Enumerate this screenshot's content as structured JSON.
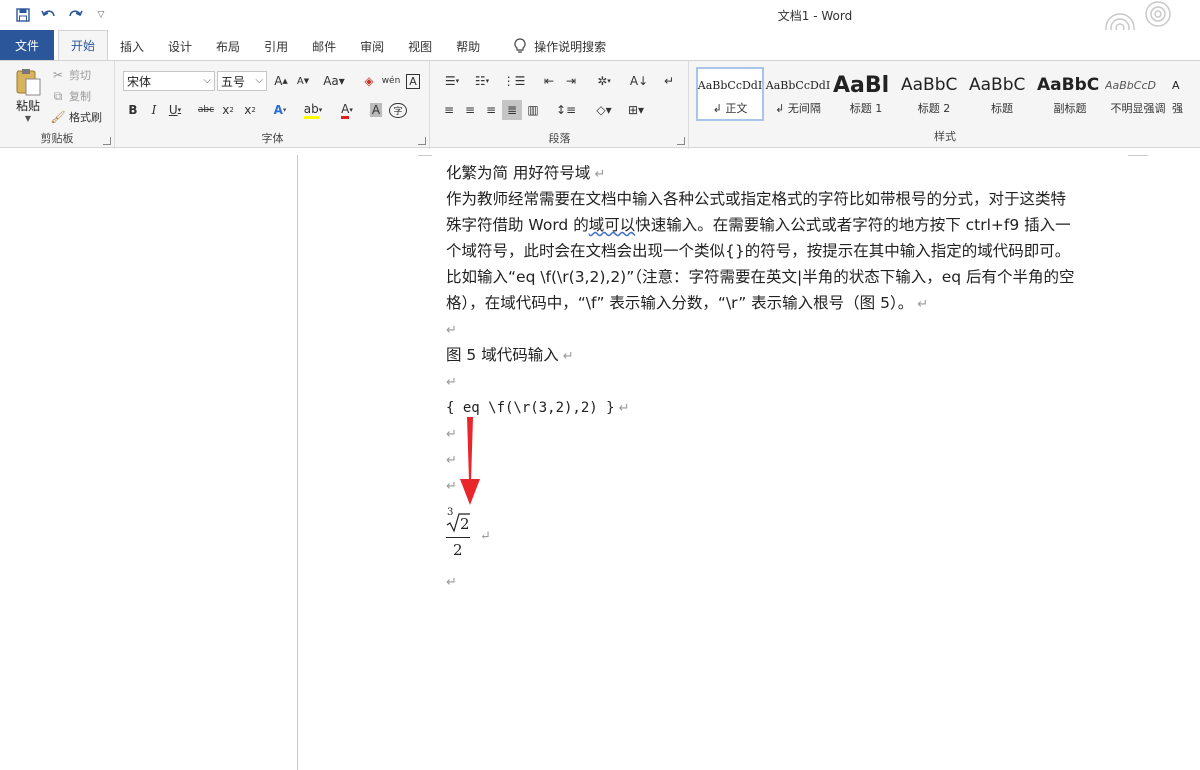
{
  "window": {
    "title": "文档1  -  Word"
  },
  "qat": {
    "save_icon": "save-icon",
    "undo_icon": "undo-icon",
    "redo_icon": "redo-icon",
    "customize_icon": "chevron-down-icon"
  },
  "tabs": {
    "file": "文件",
    "home": "开始",
    "insert": "插入",
    "design": "设计",
    "layout": "布局",
    "references": "引用",
    "mailings": "邮件",
    "review": "审阅",
    "view": "视图",
    "help": "帮助",
    "tellme": "操作说明搜索"
  },
  "clipboard": {
    "paste": "粘贴",
    "cut": "剪切",
    "copy": "复制",
    "format_painter": "格式刷",
    "label": "剪贴板"
  },
  "font": {
    "name": "宋体",
    "size": "五号",
    "label": "字体"
  },
  "paragraph": {
    "label": "段落"
  },
  "styles": {
    "label": "样式",
    "items": [
      {
        "sample": "AaBbCcDdI",
        "name": "↲ 正文"
      },
      {
        "sample": "AaBbCcDdI",
        "name": "↲ 无间隔"
      },
      {
        "sample": "AaBl",
        "name": "标题 1"
      },
      {
        "sample": "AaBbC",
        "name": "标题 2"
      },
      {
        "sample": "AaBbC",
        "name": "标题"
      },
      {
        "sample": "AaBbC",
        "name": "副标题"
      },
      {
        "sample": "AaBbCcD",
        "name": "不明显强调"
      },
      {
        "sample": "A",
        "name": "强"
      }
    ]
  },
  "document": {
    "heading": "化繁为简 用好符号域",
    "para_1": "作为教师经常需要在文档中输入各种公式或指定格式的字符比如带根号的分式，对于这类特",
    "para_2a": "殊字符借助 Word 的",
    "para_2b": "域可以",
    "para_2c": "快速输入。在需要输入公式或者字符的地方按下 ctrl+f9 插入一",
    "para_3": "个域符号，此时会在文档会出现一个类似{}的符号，按提示在其中输入指定的域代码即可。",
    "para_4": "比如输入“eq \\f(\\r(3,2),2)”（注意：字符需要在英文|半角的状态下输入，eq 后有个半角的空",
    "para_5": "格），在域代码中，“\\f” 表示输入分数，“\\r” 表示输入根号（图 5）。",
    "caption": "图 5  域代码输入",
    "field_code": "{ eq \\f(\\r(3,2),2) }",
    "formula_index": "3",
    "formula_radicand": "2",
    "formula_denominator": "2",
    "para_mark": "↵"
  },
  "colors": {
    "accent": "#2b579a",
    "arrow": "#e8262b",
    "squiggle": "#4472c4"
  }
}
